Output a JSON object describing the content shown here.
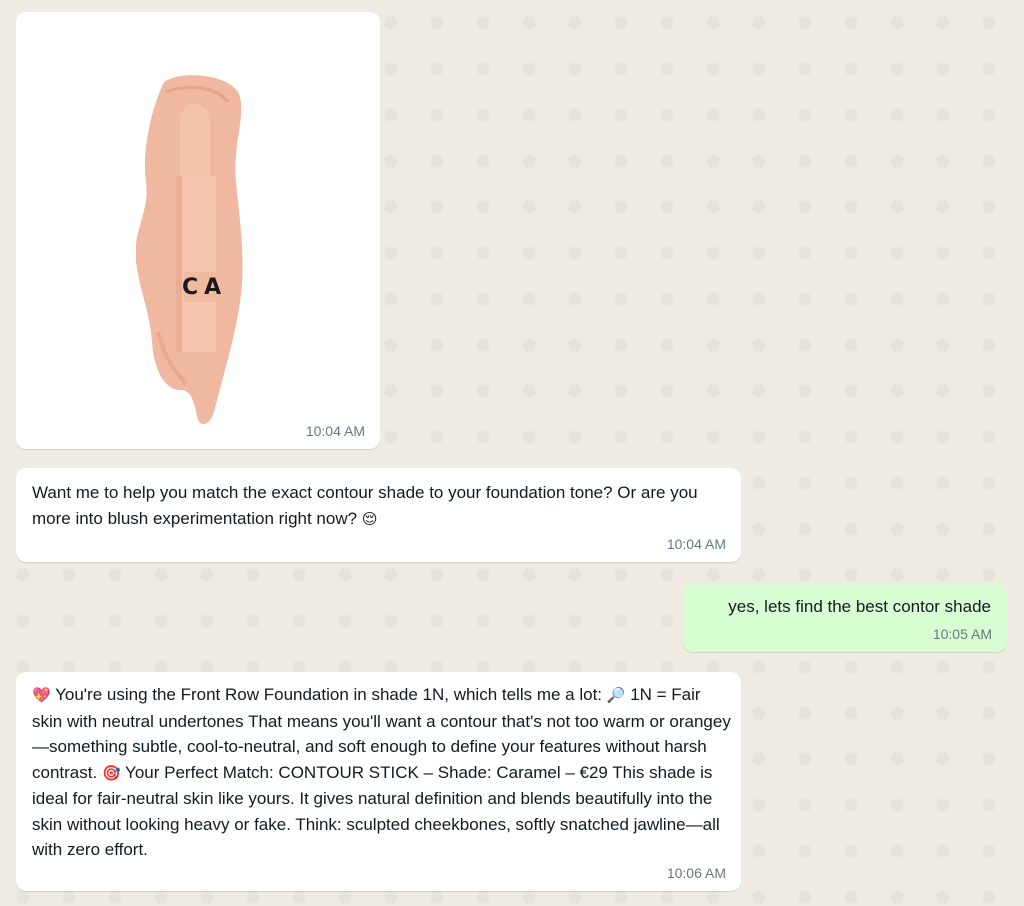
{
  "messages": [
    {
      "direction": "incoming",
      "type": "image",
      "image": {
        "description": "foundation stick with swatch",
        "brand_letters": "CA"
      },
      "time": "10:04 AM"
    },
    {
      "direction": "incoming",
      "type": "text",
      "text": "Want me to help you match the exact contour shade to your foundation tone? Or are you more into blush experimentation right now?",
      "emoji": "😌",
      "time": "10:04 AM"
    },
    {
      "direction": "outgoing",
      "type": "text",
      "text": "yes, lets find the best contor shade",
      "time": "10:05 AM"
    },
    {
      "direction": "incoming",
      "type": "text",
      "emoji_start": "💖",
      "text_part_1": "You're using the Front Row Foundation in shade 1N, which tells me a lot:",
      "emoji_mid_1": "🔎",
      "text_part_2": "1N = Fair skin with neutral undertones That means you'll want a contour that's not too warm or orangey—something subtle, cool-to-neutral, and soft enough to define your features without harsh contrast.",
      "emoji_mid_2": "🎯",
      "text_part_3": "Your Perfect Match: CONTOUR STICK – Shade: Caramel – €29 This shade is ideal for fair-neutral skin like yours. It gives natural definition and blends beautifully into the skin without looking heavy or fake. Think: sculpted cheekbones, softly snatched jawline—all with zero effort.",
      "time": "10:06 AM"
    }
  ],
  "colors": {
    "wallpaper": "#efeae2",
    "incoming_bubble": "#ffffff",
    "outgoing_bubble": "#d9fdd3",
    "timestamp": "#667781",
    "text": "#111b21",
    "product_pink": "#f0b8a0"
  }
}
